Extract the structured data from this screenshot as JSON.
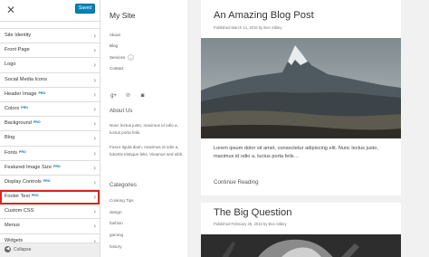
{
  "customizer": {
    "save_label": "Saved",
    "close_glyph": "✕",
    "chevron_glyph": "›",
    "items": [
      {
        "label": "Site Identity",
        "pro": ""
      },
      {
        "label": "Front Page",
        "pro": ""
      },
      {
        "label": "Logo",
        "pro": ""
      },
      {
        "label": "Social Media Icons",
        "pro": ""
      },
      {
        "label": "Header Image",
        "pro": "PRO"
      },
      {
        "label": "Colors",
        "pro": "PRO"
      },
      {
        "label": "Background",
        "pro": "PRO"
      },
      {
        "label": "Blog",
        "pro": ""
      },
      {
        "label": "Fonts",
        "pro": "PRO"
      },
      {
        "label": "Featured Image Size",
        "pro": "PRO"
      },
      {
        "label": "Display Controls",
        "pro": "PRO"
      },
      {
        "label": "Footer Text",
        "pro": "PRO"
      },
      {
        "label": "Custom CSS",
        "pro": ""
      },
      {
        "label": "Menus",
        "pro": ""
      },
      {
        "label": "Widgets",
        "pro": ""
      }
    ],
    "highlighted_item": "Footer Text",
    "collapse_label": "Collapse"
  },
  "site": {
    "title": "My Site",
    "nav": [
      "About",
      "Blog",
      "Services",
      "Contact"
    ],
    "social_icons": [
      "google-plus-icon",
      "pinterest-icon",
      "instagram-icon"
    ],
    "about_title": "About Us",
    "about_p1": "Nunc lectus justo, maximus id odio a, luctus porta felis.",
    "about_p2": "Fusce ligula diam, maximus id odio a, lobortis tristique felis. Vivamus sed nibh.",
    "categories_title": "Categories",
    "categories": [
      "Cooking Tips",
      "design",
      "fashion",
      "gaming",
      "history"
    ]
  },
  "posts": [
    {
      "title": "An Amazing Blog Post",
      "meta": "Published March 14, 2016 by Ben Sibley",
      "excerpt": "Lorem ipsum dolor sit amet, consectetur adipiscing elit. Nunc lectus justo, maximus id odio a, luctus porta felis…",
      "read_more": "Continue Reading"
    },
    {
      "title": "The Big Question",
      "meta": "Published February 26, 2016 by Ben Sibley"
    }
  ],
  "colors": {
    "accent": "#0085ba",
    "highlight_border": "#d7261e"
  }
}
